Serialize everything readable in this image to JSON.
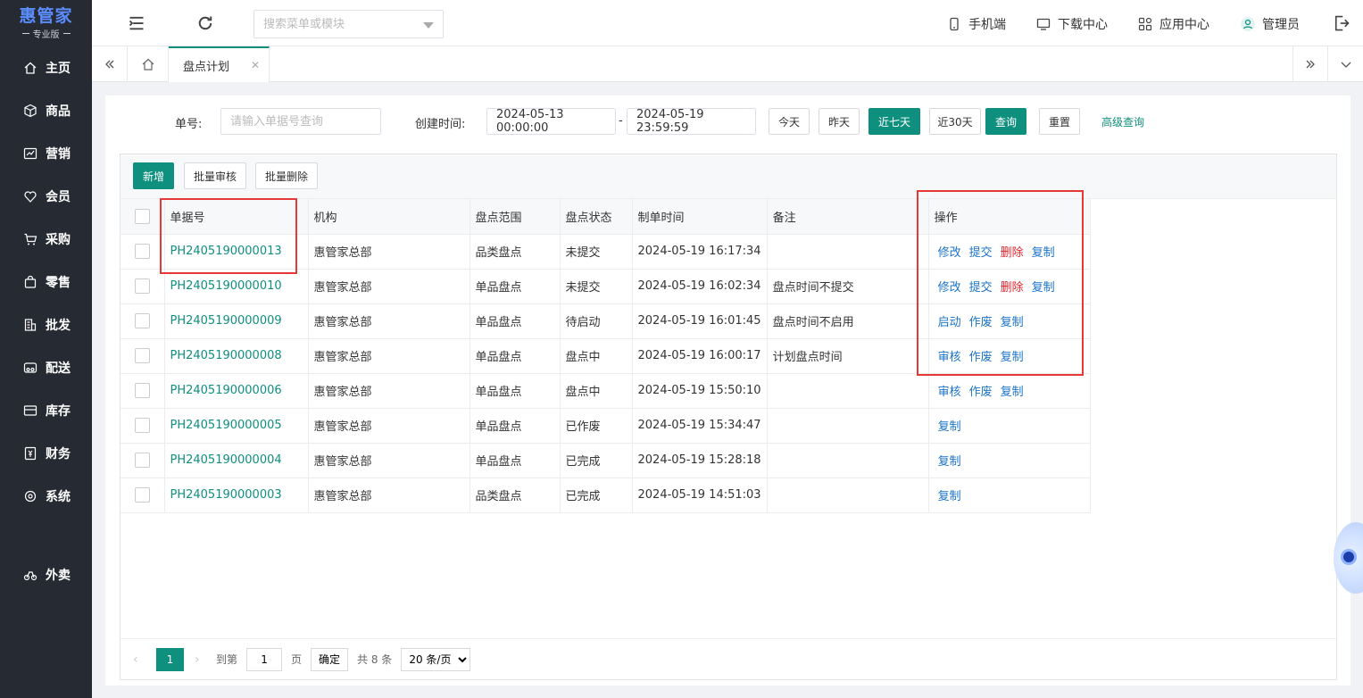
{
  "brand": {
    "name": "惠管家",
    "edition": "专业版"
  },
  "nav": [
    {
      "label": "主页",
      "icon": "home-icon"
    },
    {
      "label": "商品",
      "icon": "box-icon"
    },
    {
      "label": "营销",
      "icon": "chart-icon"
    },
    {
      "label": "会员",
      "icon": "heart-icon"
    },
    {
      "label": "采购",
      "icon": "cart-icon"
    },
    {
      "label": "零售",
      "icon": "bag-icon"
    },
    {
      "label": "批发",
      "icon": "building-icon"
    },
    {
      "label": "配送",
      "icon": "truck-icon"
    },
    {
      "label": "库存",
      "icon": "archive-icon"
    },
    {
      "label": "财务",
      "icon": "yen-icon"
    },
    {
      "label": "系统",
      "icon": "settings-icon"
    },
    {
      "label": "外卖",
      "icon": "bike-icon"
    }
  ],
  "header": {
    "search_placeholder": "搜索菜单或模块",
    "mobile": "手机端",
    "download": "下载中心",
    "apps": "应用中心",
    "user": "管理员"
  },
  "tabs": {
    "active": "盘点计划"
  },
  "filters": {
    "doc_label": "单号:",
    "doc_placeholder": "请输入单据号查询",
    "created_label": "创建时间:",
    "start": "2024-05-13 00:00:00",
    "dash": "-",
    "end": "2024-05-19 23:59:59",
    "today": "今天",
    "yesterday": "昨天",
    "last7": "近七天",
    "last30": "近30天",
    "query": "查询",
    "reset": "重置",
    "advanced": "高级查询"
  },
  "toolbar": {
    "add": "新增",
    "batch_review": "批量审核",
    "batch_delete": "批量删除"
  },
  "table": {
    "columns": [
      "单据号",
      "机构",
      "盘点范围",
      "盘点状态",
      "制单时间",
      "备注",
      "操作"
    ],
    "rows": [
      {
        "doc": "PH2405190000013",
        "org": "惠管家总部",
        "scope": "品类盘点",
        "status": "未提交",
        "time": "2024-05-19 16:17:34",
        "note": "",
        "ops": [
          "修改",
          "提交",
          "删除",
          "复制"
        ]
      },
      {
        "doc": "PH2405190000010",
        "org": "惠管家总部",
        "scope": "单品盘点",
        "status": "未提交",
        "time": "2024-05-19 16:02:34",
        "note": "盘点时间不提交",
        "ops": [
          "修改",
          "提交",
          "删除",
          "复制"
        ]
      },
      {
        "doc": "PH2405190000009",
        "org": "惠管家总部",
        "scope": "单品盘点",
        "status": "待启动",
        "time": "2024-05-19 16:01:45",
        "note": "盘点时间不启用",
        "ops": [
          "启动",
          "作废",
          "复制"
        ]
      },
      {
        "doc": "PH2405190000008",
        "org": "惠管家总部",
        "scope": "单品盘点",
        "status": "盘点中",
        "time": "2024-05-19 16:00:17",
        "note": "计划盘点时间",
        "ops": [
          "审核",
          "作废",
          "复制"
        ]
      },
      {
        "doc": "PH2405190000006",
        "org": "惠管家总部",
        "scope": "单品盘点",
        "status": "盘点中",
        "time": "2024-05-19 15:50:10",
        "note": "",
        "ops": [
          "审核",
          "作废",
          "复制"
        ]
      },
      {
        "doc": "PH2405190000005",
        "org": "惠管家总部",
        "scope": "单品盘点",
        "status": "已作废",
        "time": "2024-05-19 15:34:47",
        "note": "",
        "ops": [
          "复制"
        ]
      },
      {
        "doc": "PH2405190000004",
        "org": "惠管家总部",
        "scope": "单品盘点",
        "status": "已完成",
        "time": "2024-05-19 15:28:18",
        "note": "",
        "ops": [
          "复制"
        ]
      },
      {
        "doc": "PH2405190000003",
        "org": "惠管家总部",
        "scope": "品类盘点",
        "status": "已完成",
        "time": "2024-05-19 14:51:03",
        "note": "",
        "ops": [
          "复制"
        ]
      }
    ]
  },
  "pager": {
    "current": "1",
    "goto": "到第",
    "page_input": "1",
    "page_unit": "页",
    "confirm": "确定",
    "total": "共 8 条",
    "page_size": "20 条/页"
  },
  "colors": {
    "accent": "#0f8f7e",
    "link": "#1a73c8",
    "danger": "#e0262e",
    "highlight": "#e53935",
    "sidebar": "#262a33"
  }
}
